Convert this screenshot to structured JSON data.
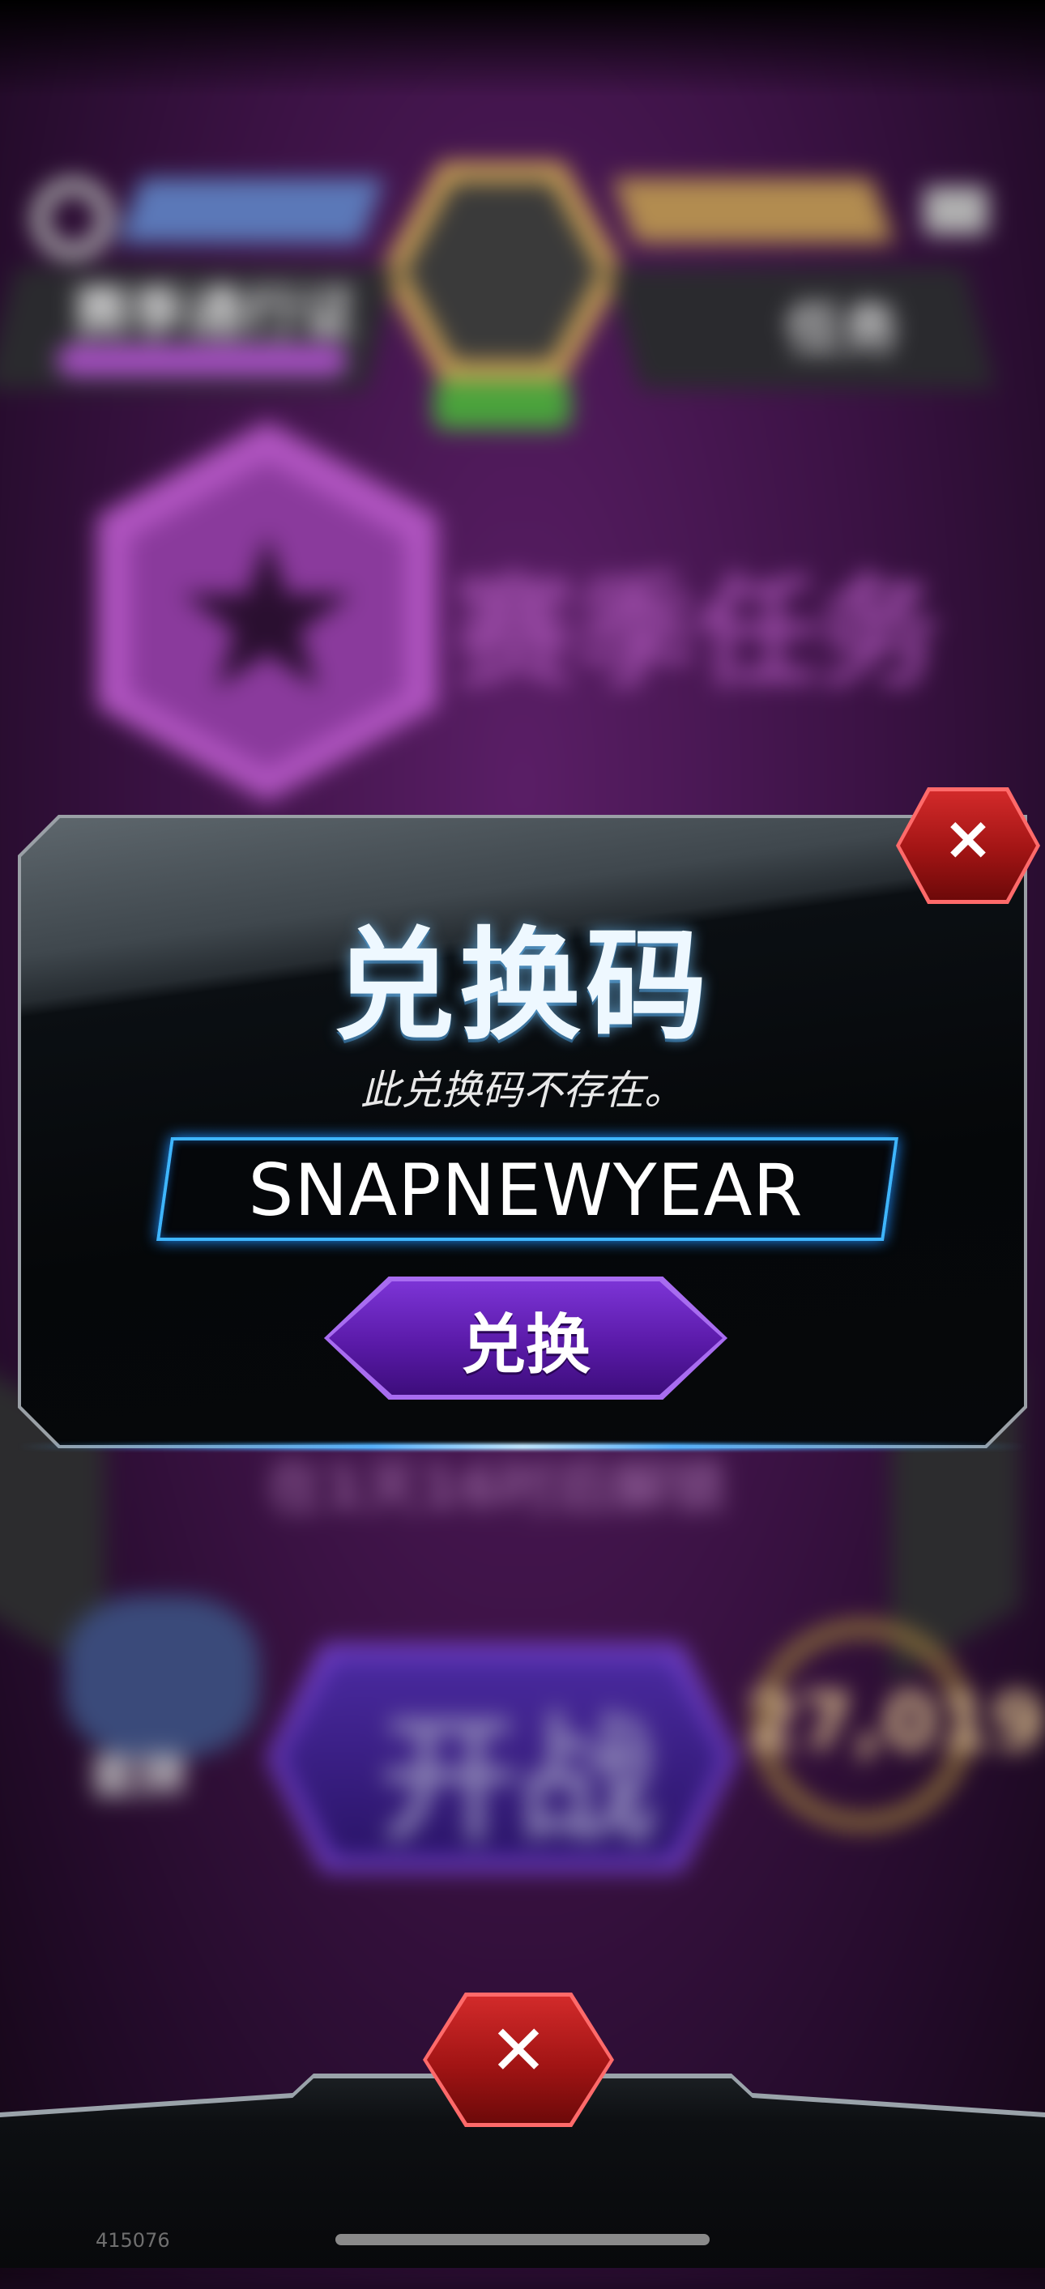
{
  "background": {
    "season_pass_label": "赛季通行证",
    "missions_label": "任务",
    "season_missions_title": "赛季任务",
    "unlock_timer": "在1天16时后解锁",
    "play_button_label": "开战",
    "deck_label": "套牌",
    "collection_level": "27,019"
  },
  "redeem_dialog": {
    "title": "兑换码",
    "message": "此兑换码不存在。",
    "code_value": "SNAPNEWYEAR",
    "redeem_button_label": "兑换",
    "close_icon": "×"
  },
  "bottom_bar": {
    "close_icon": "✕"
  },
  "build_id": "415076",
  "colors": {
    "accent_blue": "#3fb6ff",
    "button_purple": "#6a24c4",
    "close_red": "#b81b1b",
    "background_purple": "#3b1244"
  }
}
